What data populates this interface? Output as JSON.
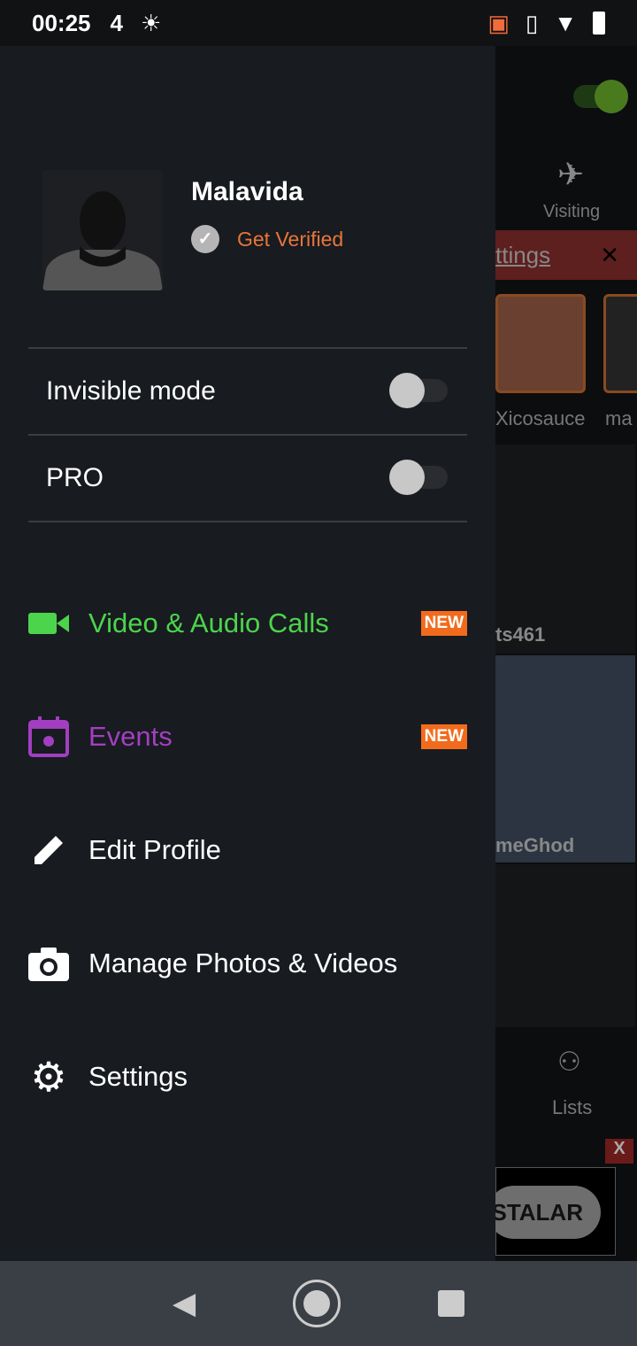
{
  "status_bar": {
    "time": "00:25",
    "icons": [
      "app-4-icon",
      "brightness-icon",
      "cast-icon",
      "vibrate-icon",
      "wifi-icon",
      "battery-icon"
    ]
  },
  "profile": {
    "name": "Malavida",
    "verify_label": "Get Verified"
  },
  "toggles": [
    {
      "label": "Invisible mode",
      "on": false
    },
    {
      "label": "PRO",
      "on": false
    }
  ],
  "menu": [
    {
      "label": "Video & Audio Calls",
      "icon": "video-camera-icon",
      "color": "#4cd44c",
      "badge": "NEW"
    },
    {
      "label": "Events",
      "icon": "calendar-icon",
      "color": "#a23fc0",
      "badge": "NEW"
    },
    {
      "label": "Edit Profile",
      "icon": "pencil-icon",
      "color": "#ffffff"
    },
    {
      "label": "Manage Photos & Videos",
      "icon": "camera-icon",
      "color": "#ffffff"
    },
    {
      "label": "Settings",
      "icon": "gear-icon",
      "color": "#ffffff"
    }
  ],
  "background": {
    "visiting": "Visiting",
    "banner_text": "ttings",
    "user1": "Xicosauce",
    "user2": "ma",
    "user3": "ts461",
    "user4": "meGhod",
    "lists": "Lists",
    "ad_button": "STALAR",
    "ad_close": "X"
  }
}
